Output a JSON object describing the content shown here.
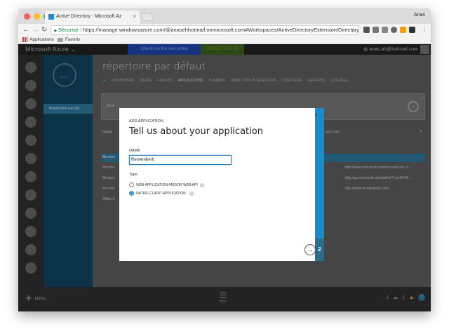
{
  "browser": {
    "tab_title": "Active Directory - Microsoft Az",
    "tab_close": "×",
    "profile": "Anas",
    "secure_label": "Sécurisé",
    "url": "https://manage.windowsazure.com/@anasehhotmail.onmicrosoft.com#Workspaces/ActiveDirectoryExtension/Directory/...",
    "bookmarks": [
      "Applications",
      "Favoris"
    ]
  },
  "azure": {
    "brand": "Microsoft Azure",
    "brand_chevron": "⌄",
    "promo_portal": "Check out the new portal",
    "promo_credit": "CREDIT STATUS",
    "account": "anas.ah@hotmail.com",
    "page_title": "répertoire par défaut",
    "subnav_item": "Répertoire par dé...",
    "menu": [
      "DASHBOARD",
      "USERS",
      "GROUPS",
      "APPLICATIONS",
      "DOMAINS",
      "DIRECTORY INTEGRATION",
      "CONFIGURE",
      "REPORTS",
      "LICENSES"
    ],
    "menu_active": "APPLICATIONS",
    "panel_text": "Show",
    "table_header_left": "NAME",
    "table_header_right": "APP URI",
    "rows_left": [
      "Microso",
      "Microso",
      "Microso",
      "Microso",
      "Office 3"
    ],
    "rows_right": [
      "http://www.microsoft.com/en-us/server-cl...",
      "http://go.microsoft.com/fwlink/?LinkId=82...",
      "http://www.visualstudio.com/"
    ],
    "new_label": "NEW",
    "add_label": "ADD",
    "status_cloud_count": "1",
    "status_warn_count": "1",
    "help_label": "?"
  },
  "dialog": {
    "kicker": "ADD APPLICATION",
    "title": "Tell us about your application",
    "name_label": "NAME",
    "name_value": "RememberIt",
    "type_label": "Type",
    "option_web": "WEB APPLICATION AND/OR WEB API",
    "option_native": "NATIVE CLIENT APPLICATION",
    "selected_option": "NATIVE CLIENT APPLICATION",
    "step": "2",
    "close": "×",
    "next_arrow": "→"
  },
  "colors": {
    "azure_blue": "#1b8bc9",
    "dialog_step_bg": "#2a6d8f",
    "subnav_bg": "#0e3d57"
  }
}
